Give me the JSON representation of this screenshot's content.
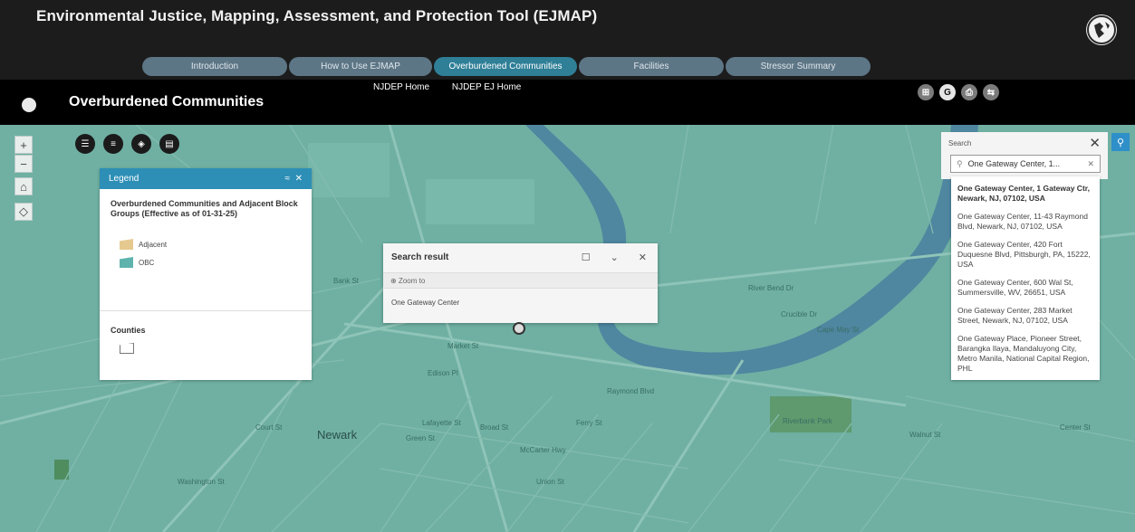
{
  "header": {
    "app_title": "Environmental Justice, Mapping, Assessment, and Protection Tool (EJMAP)",
    "tabs": [
      {
        "label": "Introduction",
        "active": false
      },
      {
        "label": "How to Use EJMAP",
        "active": false
      },
      {
        "label": "Overburdened Communities",
        "active": true
      },
      {
        "label": "Facilities",
        "active": false
      },
      {
        "label": "Stressor Summary",
        "active": false
      }
    ]
  },
  "subheader": {
    "page_title": "Overburdened Communities",
    "links": [
      "NJDEP Home",
      "NJDEP EJ Home"
    ],
    "tools": [
      {
        "icon": "grid-icon",
        "glyph": "⊞"
      },
      {
        "icon": "g-icon",
        "glyph": "G"
      },
      {
        "icon": "print-icon",
        "glyph": "⎙"
      },
      {
        "icon": "swap-icon",
        "glyph": "⇆"
      }
    ]
  },
  "map_controls": {
    "zoom_in": "+",
    "zoom_out": "−",
    "home": "⌂",
    "locate": "◇"
  },
  "widget_bar": [
    {
      "icon": "layers-list-icon",
      "glyph": "☰"
    },
    {
      "icon": "legend-icon",
      "glyph": "≡"
    },
    {
      "icon": "basemap-icon",
      "glyph": "◈"
    },
    {
      "icon": "folder-icon",
      "glyph": "▤"
    }
  ],
  "legend": {
    "header": "Legend",
    "title": "Overburdened Communities and Adjacent Block Groups (Effective as of 01-31-25)",
    "items": [
      {
        "label": "Adjacent",
        "color": "#e6c98f"
      },
      {
        "label": "OBC",
        "color": "#5fb3ad"
      }
    ],
    "counties_label": "Counties"
  },
  "popup": {
    "title": "Search result",
    "zoom_to": "Zoom to",
    "body": "One Gateway Center"
  },
  "search": {
    "label": "Search",
    "value": "One Gateway Center, 1...",
    "suggestions": [
      "One Gateway Center, 1 Gateway Ctr, Newark, NJ, 07102, USA",
      "One Gateway Center, 11-43 Raymond Blvd, Newark, NJ, 07102, USA",
      "One Gateway Center, 420 Fort Duquesne Blvd, Pittsburgh, PA, 15222, USA",
      "One Gateway Center, 600 Wal St, Summersville, WV, 26651, USA",
      "One Gateway Center, 283 Market Street, Newark, NJ, 07102, USA",
      "One Gateway Place, Pioneer Street, Barangka Ilaya, Mandaluyong City, Metro Manila, National Capital Region, PHL"
    ]
  },
  "map_labels": {
    "city": "Newark",
    "streets": [
      "Market St",
      "Raymond Blvd",
      "Edison Pl",
      "Court St",
      "Lafayette St",
      "Ferry St",
      "Green St",
      "McCarter Hwy",
      "Broad St",
      "River Bend Dr",
      "Crucible Dr",
      "Cape May St",
      "Riverbank Park",
      "Washington St",
      "Center St",
      "Bank St",
      "Union St",
      "Walnut St"
    ]
  }
}
